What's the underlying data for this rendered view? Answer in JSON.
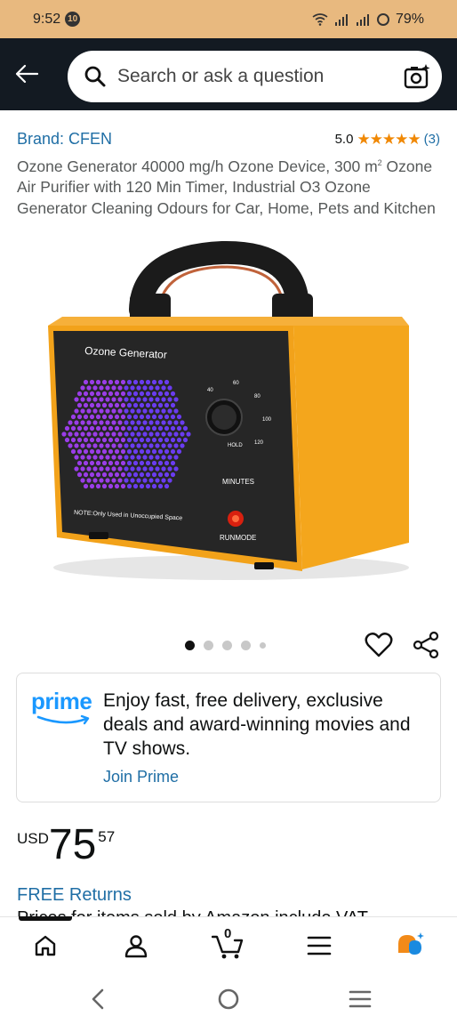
{
  "status_bar": {
    "time": "9:52",
    "notification_count": "10",
    "battery": "79%"
  },
  "search": {
    "placeholder": "Search or ask a question"
  },
  "product": {
    "brand": "Brand: CFEN",
    "rating_value": "5.0",
    "stars": "★★★★★",
    "rating_count": "(3)",
    "title_line1": "Ozone Generator 40000 mg/h Ozone Device, 300 m",
    "title_superscript": "2",
    "title_rest": "Ozone Air Purifier with 120 Min Timer, Industrial O3 Ozone Generator Cleaning Odours for Car, Home, Pets and Kitchen",
    "image_panel_label": "Ozone Generator",
    "image_note": "NOTE:Only Used in Unoccupied Space",
    "image_minutes_label": "MINUTES",
    "image_runmode_label": "RUNMODE",
    "image_hold_label": "HOLD",
    "image_dial_marks": [
      "40",
      "60",
      "80",
      "100",
      "120"
    ],
    "carousel": {
      "count": 5,
      "active_index": 0
    }
  },
  "prime": {
    "logo": "prime",
    "text": "Enjoy fast, free delivery, exclusive deals and award-winning movies and TV shows.",
    "join_label": "Join Prime"
  },
  "price": {
    "currency": "USD",
    "whole": "75",
    "fraction": "57"
  },
  "free_returns": "FREE Returns",
  "vat_note": "Prices for items sold by Amazon include VAT",
  "bottom_nav": {
    "cart_count": "0",
    "items": [
      "home-icon",
      "account-icon",
      "cart-icon",
      "menu-icon",
      "rufus-icon"
    ]
  },
  "colors": {
    "link": "#1f6ea5",
    "star": "#f08804",
    "header_bg": "#131a22",
    "status_bg": "#e8b97f",
    "prime_blue": "#1a98ff"
  }
}
